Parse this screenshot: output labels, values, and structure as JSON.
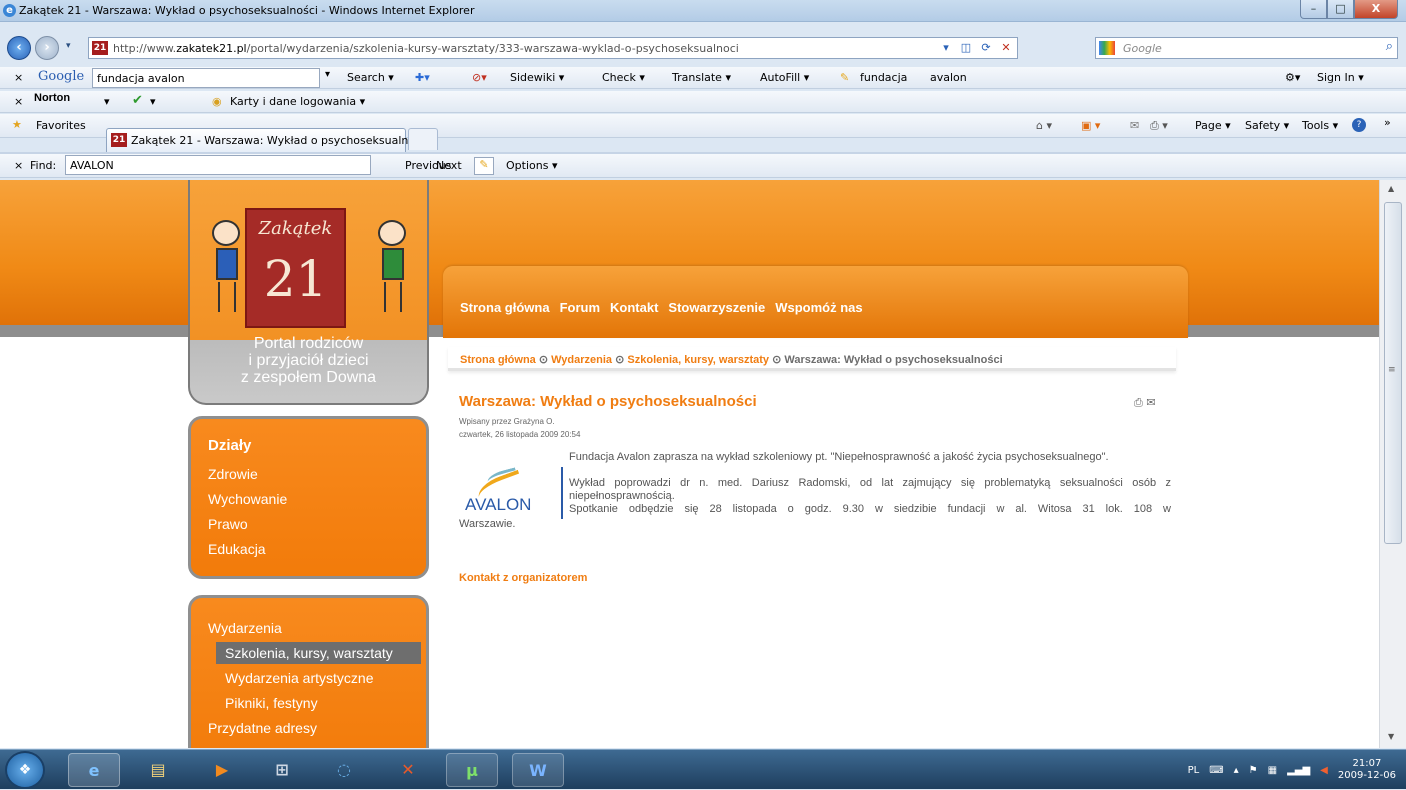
{
  "window": {
    "title": "Zakątek 21 - Warszawa: Wykład o psychoseksualności - Windows Internet Explorer",
    "minimize": "–",
    "maximize": "□",
    "close": "X"
  },
  "address": {
    "favicon": "21",
    "url_prefix": "http://www.",
    "url_domain": "zakatek21.pl",
    "url_path": "/portal/wydarzenia/szkolenia-kursy-warsztaty/333-warszawa-wyklad-o-psychoseksualnoci",
    "search_placeholder": "Google"
  },
  "google_toolbar": {
    "close": "×",
    "logo": "Google",
    "query": "fundacja avalon",
    "search": "Search ▾",
    "sidewiki": "Sidewiki ▾",
    "check": "Check ▾",
    "translate": "Translate ▾",
    "autofill": "AutoFill ▾",
    "term1": "fundacja",
    "term2": "avalon",
    "signin": "Sign In ▾"
  },
  "norton_toolbar": {
    "close": "×",
    "logo": "Norton",
    "dropdown": "▾",
    "check_dropdown": "▾",
    "cards": "Karty i dane logowania ▾"
  },
  "favorites_bar": {
    "favorites": "Favorites",
    "tab_favicon": "21",
    "tab_title": "Zakątek 21 - Warszawa: Wykład o psychoseksualn...",
    "page": "Page ▾",
    "safety": "Safety ▾",
    "tools": "Tools ▾",
    "help": "?",
    "more": "»"
  },
  "find_bar": {
    "close": "×",
    "label": "Find:",
    "value": "AVALON",
    "previous": "Previous",
    "next": "Next",
    "options": "Options ▾"
  },
  "site": {
    "logo_word": "Zakątek",
    "logo_number": "21",
    "tagline_1": "Portal rodziców",
    "tagline_2": "i przyjaciół dzieci",
    "tagline_3": "z zespołem Downa",
    "nav": [
      "Strona główna",
      "Forum",
      "Kontakt",
      "Stowarzyszenie",
      "Wspomóż nas"
    ],
    "sections_heading": "Działy",
    "sections": [
      "Zdrowie",
      "Wychowanie",
      "Prawo",
      "Edukacja"
    ],
    "events_heading": "Wydarzenia",
    "events": [
      "Szkolenia, kursy, warsztaty",
      "Wydarzenia artystyczne",
      "Pikniki, festyny"
    ],
    "useful": "Przydatne adresy"
  },
  "breadcrumb": {
    "items": [
      "Strona główna",
      "Wydarzenia",
      "Szkolenia, kursy, warsztaty",
      "Warszawa: Wykład o psychoseksualności"
    ]
  },
  "article": {
    "title": "Warszawa: Wykład o psychoseksualności",
    "author": "Wpisany przez Grażyna O.",
    "date": "czwartek, 26 listopada 2009 20:54",
    "logo_text": "AVALON",
    "p1": "Fundacja Avalon zaprasza na wykład szkoleniowy pt. \"Niepełnosprawność a jakość życia psychoseksualnego\".",
    "p2": "Wykład poprowadzi dr n. med. Dariusz Radomski, od lat zajmujący się problematyką seksualności osób z niepełnosprawnością.",
    "p3a": "Spotkanie odbędzie się 28 listopada o godz. 9.30 w siedzibie fundacji w al. Witosa 31 lok. 108 w",
    "p3b": "Warszawie.",
    "contact": "Kontakt z organizatorem"
  },
  "taskbar": {
    "language": "PL",
    "time": "21:07",
    "date": "2009-12-06"
  }
}
